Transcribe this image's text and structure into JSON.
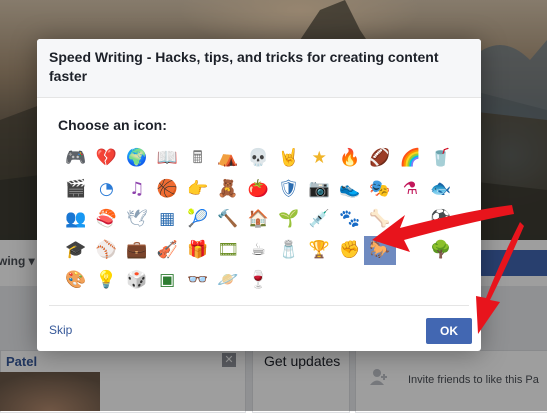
{
  "background": {
    "following_label": "wing ▾",
    "profile_name": "Patel",
    "close_glyph": "✕",
    "get_updates": "Get updates",
    "invite_text": "Invite friends to like this Pa",
    "invite_icon": "add-person-icon",
    "brand_color": "#4267b2"
  },
  "dialog": {
    "title": "Speed Writing - Hacks, tips, and tricks for creating content faster",
    "subtitle": "Choose an icon:",
    "skip_label": "Skip",
    "ok_label": "OK",
    "selected_icon_index": 49,
    "selection_color": "#6f8ac0",
    "icons": [
      {
        "name": "gamepad-icon",
        "glyph": "🎮",
        "color": "#555"
      },
      {
        "name": "broken-heart-icon",
        "glyph": "💔",
        "color": "#e0245e"
      },
      {
        "name": "globe-icon",
        "glyph": "🌍",
        "color": "#2a7ab0"
      },
      {
        "name": "open-book-icon",
        "glyph": "📖",
        "color": "#4a7db5"
      },
      {
        "name": "calculator-icon",
        "glyph": "🖩",
        "color": "#777"
      },
      {
        "name": "tent-icon",
        "glyph": "⛺",
        "color": "#e8882a"
      },
      {
        "name": "skull-icon",
        "glyph": "💀",
        "color": "#666"
      },
      {
        "name": "rock-hand-icon",
        "glyph": "🤘",
        "color": "#c58a5a"
      },
      {
        "name": "star-badge-icon",
        "glyph": "★",
        "color": "#f0b429"
      },
      {
        "name": "fire-icon",
        "glyph": "🔥",
        "color": "#f28b1a"
      },
      {
        "name": "football-icon",
        "glyph": "🏈",
        "color": "#8b4513"
      },
      {
        "name": "rainbow-icon",
        "glyph": "🌈",
        "color": "#d35400"
      },
      {
        "name": "red-cup-icon",
        "glyph": "🥤",
        "color": "#d93025"
      },
      {
        "name": "clapperboard-icon",
        "glyph": "🎬",
        "color": "#333"
      },
      {
        "name": "pie-chart-icon",
        "glyph": "◔",
        "color": "#2b7bd6"
      },
      {
        "name": "music-notes-icon",
        "glyph": "♫",
        "color": "#8e44ad"
      },
      {
        "name": "basketball-icon",
        "glyph": "🏀",
        "color": "#e67e22"
      },
      {
        "name": "pointing-hand-icon",
        "glyph": "👉",
        "color": "#c58a5a"
      },
      {
        "name": "teddy-bear-icon",
        "glyph": "🧸",
        "color": "#b07a4a"
      },
      {
        "name": "tomato-icon",
        "glyph": "🍅",
        "color": "#d93025"
      },
      {
        "name": "shield-icon",
        "glyph": "🛡",
        "color": "#2b6cb0"
      },
      {
        "name": "camera-icon",
        "glyph": "📷",
        "color": "#555"
      },
      {
        "name": "sneaker-icon",
        "glyph": "👟",
        "color": "#2b7bd6"
      },
      {
        "name": "theater-masks-icon",
        "glyph": "🎭",
        "color": "#d4a017"
      },
      {
        "name": "flask-icon",
        "glyph": "⚗",
        "color": "#c2185b"
      },
      {
        "name": "fish-icon",
        "glyph": "🐟",
        "color": "#2b7bd6"
      },
      {
        "name": "group-icon",
        "glyph": "👥",
        "color": "#4267b2"
      },
      {
        "name": "sushi-icon",
        "glyph": "🍣",
        "color": "#333"
      },
      {
        "name": "dove-icon",
        "glyph": "🕊",
        "color": "#8aa0b5"
      },
      {
        "name": "grid-icon",
        "glyph": "▦",
        "color": "#2b6cb0"
      },
      {
        "name": "tennis-ball-icon",
        "glyph": "🎾",
        "color": "#c8d41e"
      },
      {
        "name": "gavel-icon",
        "glyph": "🔨",
        "color": "#8b5a2b"
      },
      {
        "name": "house-icon",
        "glyph": "🏠",
        "color": "#8b5a2b"
      },
      {
        "name": "sprout-icon",
        "glyph": "🌱",
        "color": "#3c9a3c"
      },
      {
        "name": "syringe-icon",
        "glyph": "💉",
        "color": "#7aa0c8"
      },
      {
        "name": "paw-print-icon",
        "glyph": "🐾",
        "color": "#b07a4a"
      },
      {
        "name": "bone-icon",
        "glyph": "🦴",
        "color": "#c9a27a"
      },
      {
        "name": "blank-icon",
        "glyph": "",
        "color": "#fff"
      },
      {
        "name": "soccer-ball-icon",
        "glyph": "⚽",
        "color": "#333"
      },
      {
        "name": "graduation-cap-icon",
        "glyph": "🎓",
        "color": "#333"
      },
      {
        "name": "baseball-icon",
        "glyph": "⚾",
        "color": "#c0392b"
      },
      {
        "name": "briefcase-icon",
        "glyph": "💼",
        "color": "#8b5a2b"
      },
      {
        "name": "violin-icon",
        "glyph": "🎻",
        "color": "#a0522d"
      },
      {
        "name": "gift-icon",
        "glyph": "🎁",
        "color": "#e0245e"
      },
      {
        "name": "film-frames-icon",
        "glyph": "🎞",
        "color": "#6b8e23"
      },
      {
        "name": "coffee-cup-icon",
        "glyph": "☕",
        "color": "#666"
      },
      {
        "name": "salt-shaker-icon",
        "glyph": "🧂",
        "color": "#777"
      },
      {
        "name": "trophy-icon",
        "glyph": "🏆",
        "color": "#d4a017"
      },
      {
        "name": "raised-fist-icon",
        "glyph": "✊",
        "color": "#e0a060"
      },
      {
        "name": "horse-icon",
        "glyph": "🐎",
        "color": "#8b4513"
      },
      {
        "name": "blank-icon",
        "glyph": "",
        "color": "#fff"
      },
      {
        "name": "tree-icon",
        "glyph": "🌳",
        "color": "#3c9a3c"
      },
      {
        "name": "palette-icon",
        "glyph": "🎨",
        "color": "#d4a017"
      },
      {
        "name": "light-bulb-icon",
        "glyph": "💡",
        "color": "#f0c419"
      },
      {
        "name": "dice-icon",
        "glyph": "🎲",
        "color": "#d93025"
      },
      {
        "name": "chip-icon",
        "glyph": "▣",
        "color": "#2e7d32"
      },
      {
        "name": "glasses-icon",
        "glyph": "👓",
        "color": "#333"
      },
      {
        "name": "planet-icon",
        "glyph": "🪐",
        "color": "#e67e22"
      },
      {
        "name": "wine-glass-icon",
        "glyph": "🍷",
        "color": "#b0303c"
      }
    ]
  }
}
